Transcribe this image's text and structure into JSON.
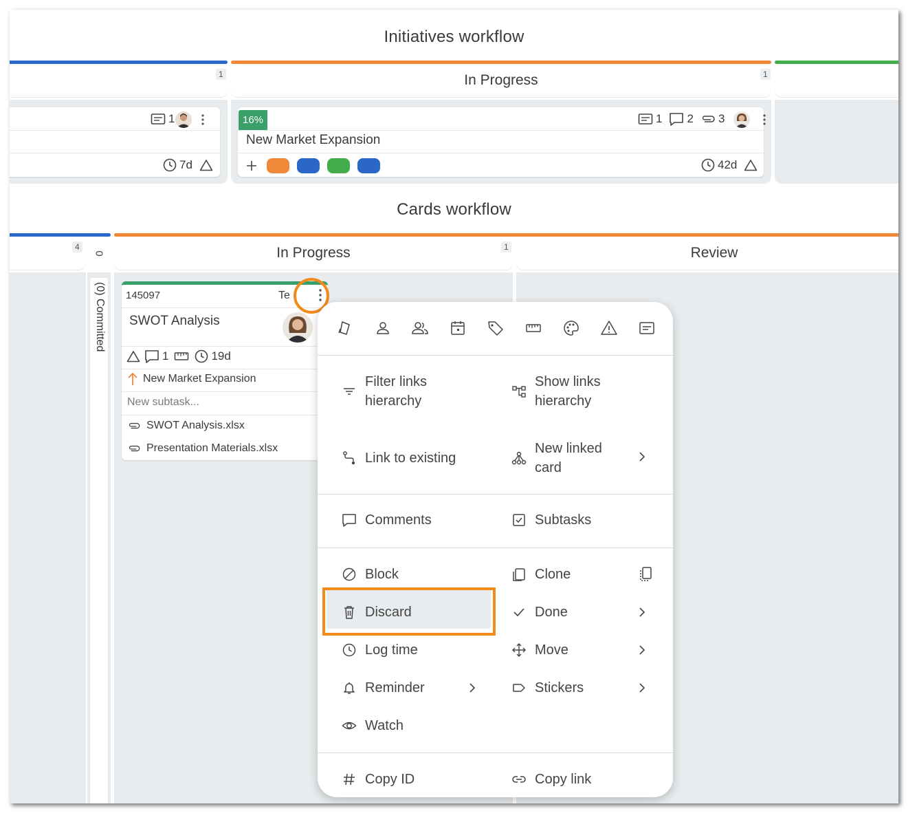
{
  "initiatives": {
    "title": "Initiatives workflow",
    "left_column": {
      "count": "1",
      "color": "#2b67c6"
    },
    "in_progress": {
      "title": "In Progress",
      "count": "1",
      "color": "#f0883a"
    },
    "right_column": {
      "color": "#42ad4a"
    },
    "left_card": {
      "attachments": "1",
      "duration": "7d"
    },
    "card": {
      "progress": "16%",
      "progress_color": "#3aa06a",
      "title": "New Market Expansion",
      "attachments": "1",
      "comments": "2",
      "links": "3",
      "duration": "42d",
      "pill_colors": [
        "#f0883a",
        "#2b67c6",
        "#42ad4a",
        "#2b67c6"
      ]
    }
  },
  "cards": {
    "title": "Cards workflow",
    "left_column": {
      "count": "4",
      "color": "#2b67c6"
    },
    "committed_lane": {
      "count": "0",
      "label": "(0) Committed"
    },
    "in_progress": {
      "title": "In Progress",
      "count": "1",
      "color": "#f0883a"
    },
    "review": {
      "title": "Review"
    },
    "card": {
      "id": "145097",
      "type_partial": "Te",
      "title": "SWOT Analysis",
      "comments": "1",
      "duration": "19d",
      "parent_link": "New Market Expansion",
      "subtask_placeholder": "New subtask...",
      "files": [
        "SWOT Analysis.xlsx",
        "Presentation Materials.xlsx"
      ],
      "top_color": "#3aa06a"
    }
  },
  "highlight_color": "#f28a1c",
  "menu": {
    "toolbar_icons": [
      "card-type-icon",
      "assignee-icon",
      "co-owners-icon",
      "calendar-icon",
      "tag-icon",
      "size-ruler-icon",
      "color-palette-icon",
      "priority-warning-icon",
      "template-card-icon"
    ],
    "links_section": {
      "filter_links": "Filter links\nhierarchy",
      "show_links": "Show links\nhierarchy",
      "link_existing": "Link to existing",
      "new_linked": "New linked\ncard"
    },
    "comments": "Comments",
    "subtasks": "Subtasks",
    "block": "Block",
    "clone": "Clone",
    "discard": "Discard",
    "done": "Done",
    "log_time": "Log time",
    "move": "Move",
    "reminder": "Reminder",
    "stickers": "Stickers",
    "watch": "Watch",
    "copy_id": "Copy ID",
    "copy_link": "Copy link"
  }
}
